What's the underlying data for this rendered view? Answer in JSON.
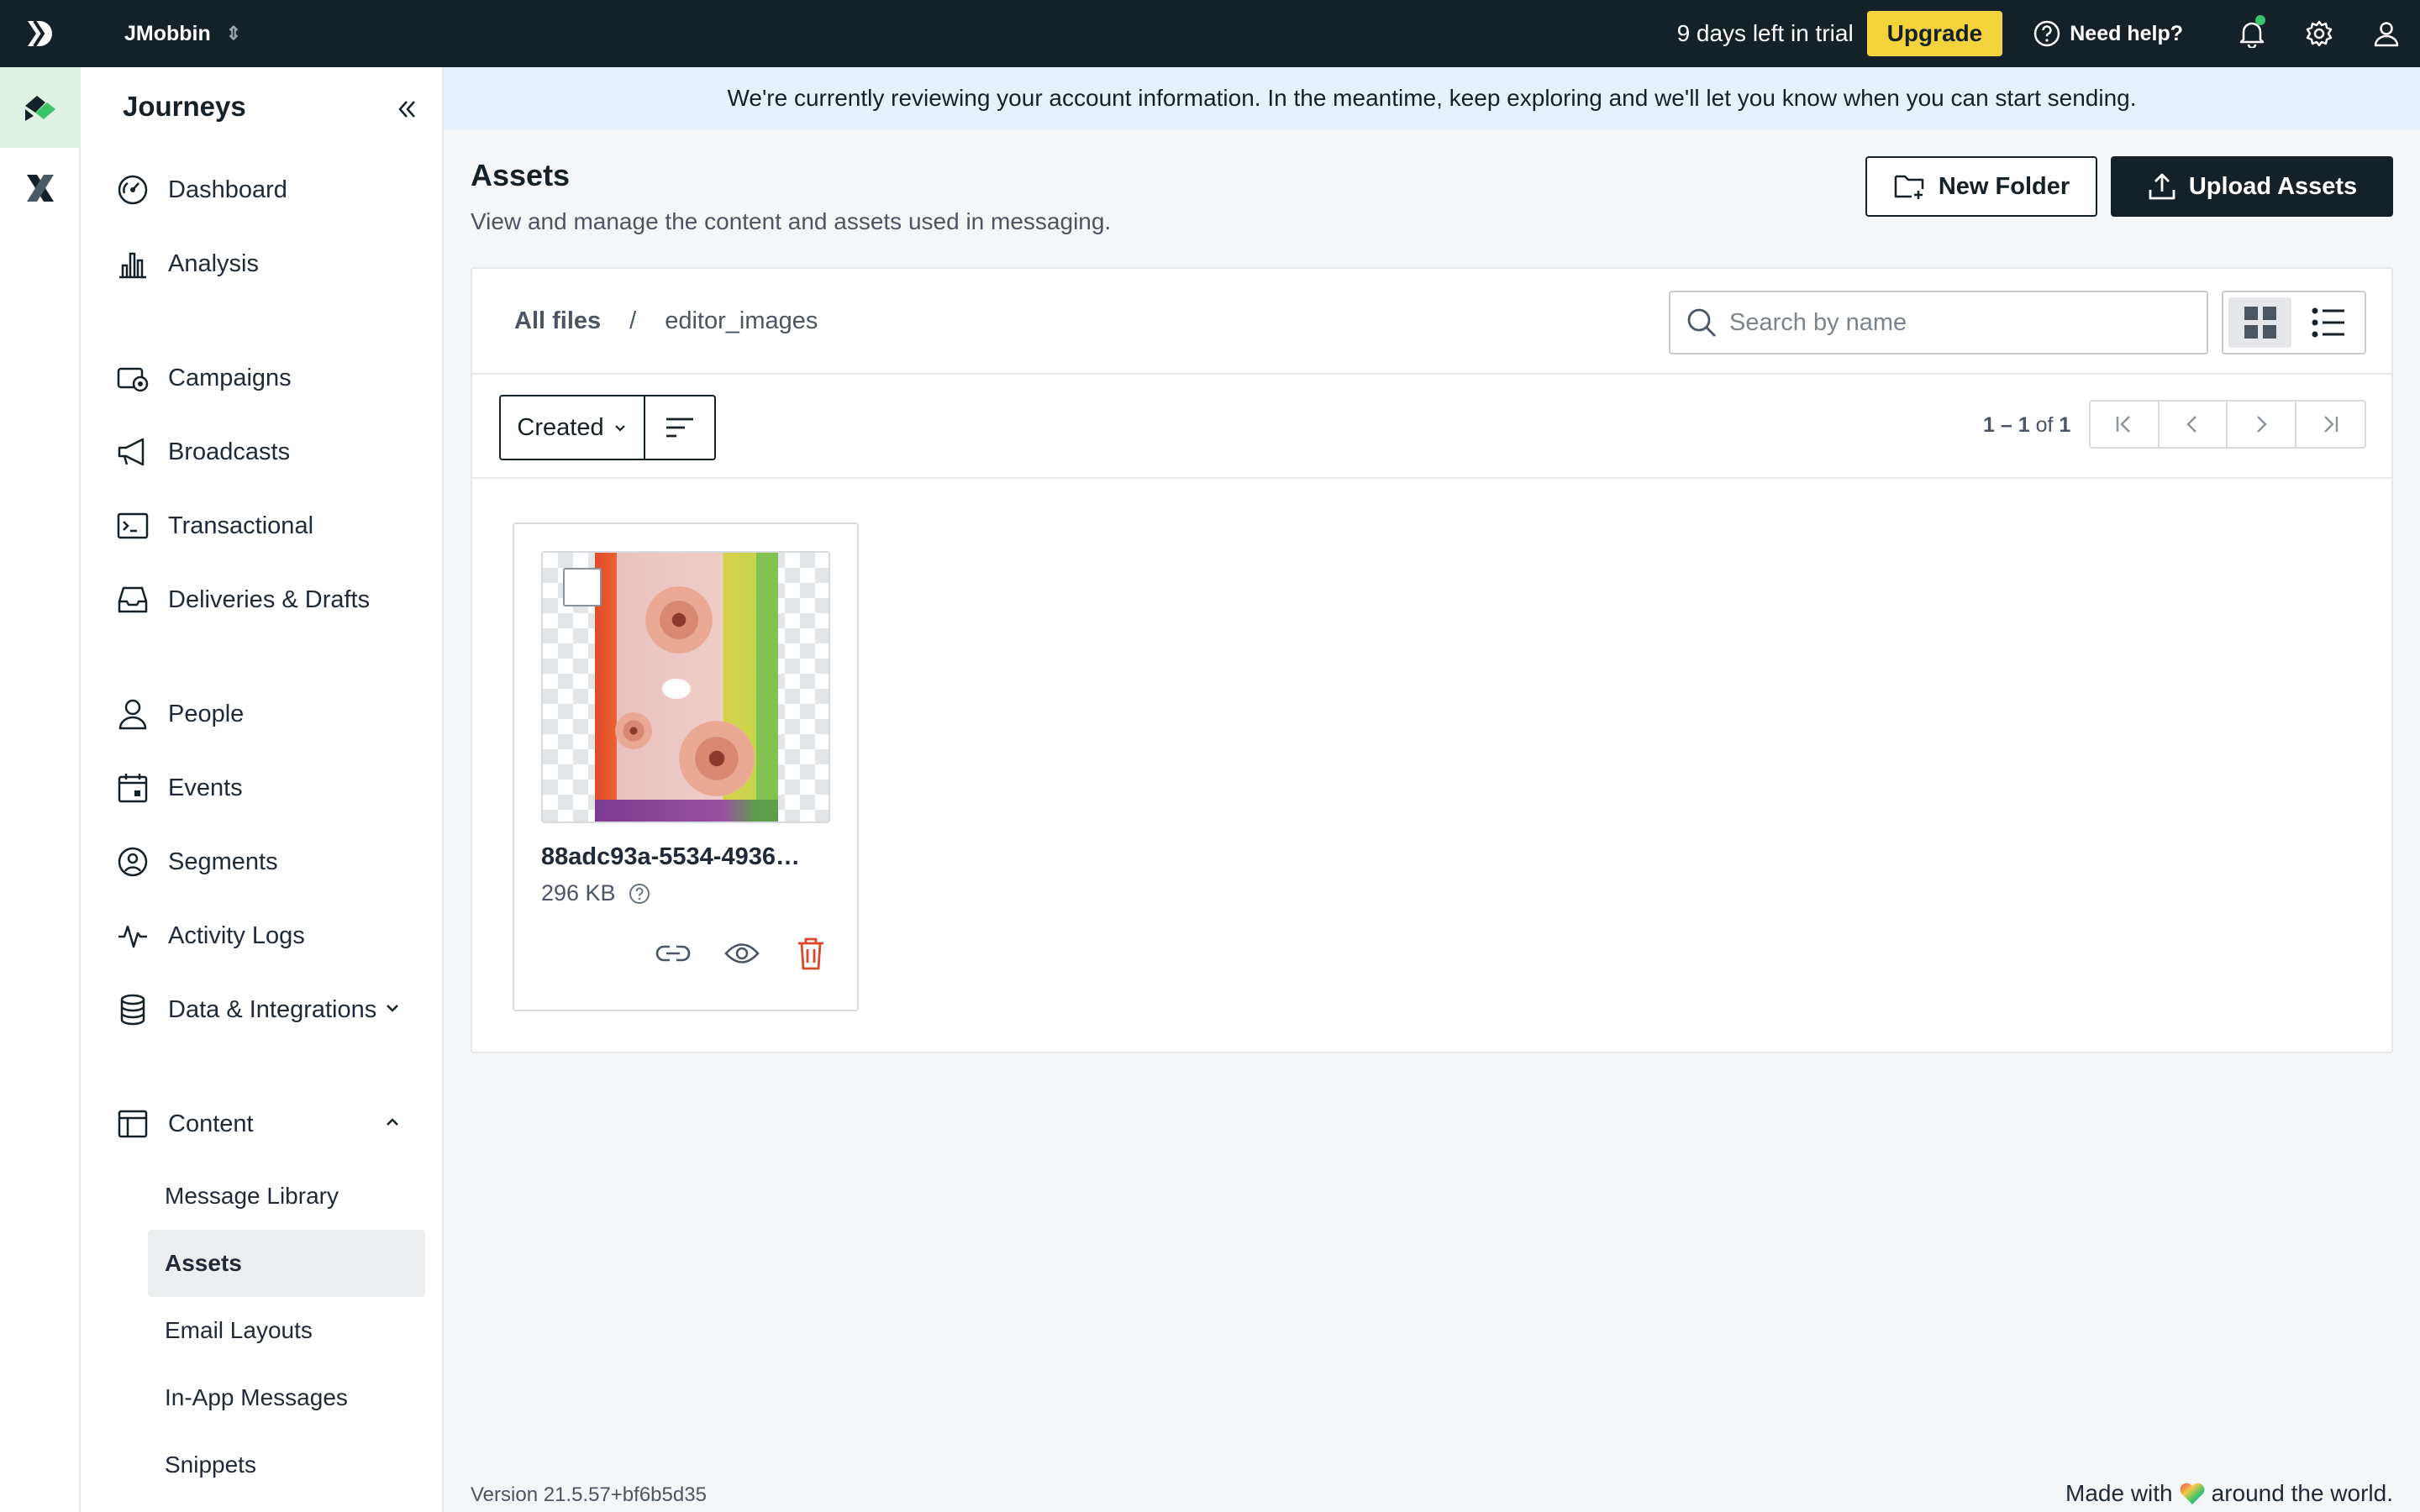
{
  "topbar": {
    "workspace": "JMobbin",
    "trial_text": "9 days left in trial",
    "upgrade_label": "Upgrade",
    "help_label": "Need help?"
  },
  "banner": {
    "text": "We're currently reviewing your account information. In the meantime, keep exploring and we'll let you know when you can start sending."
  },
  "sidebar": {
    "title": "Journeys",
    "items": [
      {
        "label": "Dashboard",
        "icon": "dashboard-icon"
      },
      {
        "label": "Analysis",
        "icon": "bar-chart-icon"
      },
      {
        "label": "Campaigns",
        "icon": "campaigns-icon"
      },
      {
        "label": "Broadcasts",
        "icon": "megaphone-icon"
      },
      {
        "label": "Transactional",
        "icon": "terminal-icon"
      },
      {
        "label": "Deliveries & Drafts",
        "icon": "inbox-icon"
      },
      {
        "label": "People",
        "icon": "person-icon"
      },
      {
        "label": "Events",
        "icon": "calendar-icon"
      },
      {
        "label": "Segments",
        "icon": "segments-icon"
      },
      {
        "label": "Activity Logs",
        "icon": "pulse-icon"
      },
      {
        "label": "Data & Integrations",
        "icon": "database-icon"
      },
      {
        "label": "Content",
        "icon": "layout-icon"
      }
    ],
    "content_subitems": [
      {
        "label": "Message Library"
      },
      {
        "label": "Assets"
      },
      {
        "label": "Email Layouts"
      },
      {
        "label": "In-App Messages"
      },
      {
        "label": "Snippets"
      }
    ]
  },
  "main": {
    "title": "Assets",
    "subtitle": "View and manage the content and assets used in messaging.",
    "new_folder_label": "New Folder",
    "upload_label": "Upload Assets",
    "breadcrumb": {
      "root": "All files",
      "separator": "/",
      "current": "editor_images"
    },
    "search_placeholder": "Search by name",
    "sort_label": "Created",
    "pagination": {
      "range": "1 – 1",
      "of": "of",
      "total": "1"
    },
    "assets": [
      {
        "name": "88adc93a-5534-4936…",
        "size": "296 KB"
      }
    ]
  },
  "footer": {
    "version": "Version 21.5.57+bf6b5d35",
    "made_with_pre": "Made with",
    "made_with_post": "around the world."
  },
  "colors": {
    "topbar": "#152128",
    "upgrade": "#f5d33d",
    "banner": "#e7f1fb",
    "rail_active": "#dff3e5",
    "delete": "#d64a2b"
  }
}
